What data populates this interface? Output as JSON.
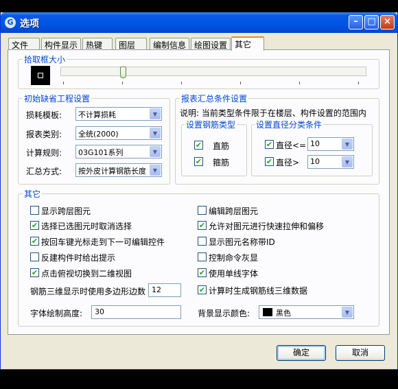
{
  "window": {
    "title": "选项"
  },
  "tabs": [
    "文件",
    "构件显示",
    "热键",
    "图层",
    "编制信息",
    "绘图设置",
    "其它"
  ],
  "pick_box": {
    "title": "拾取框大小"
  },
  "defaults_group": {
    "title": "初始缺省工程设置",
    "rows": [
      {
        "label": "损耗模板:",
        "value": "不计算损耗"
      },
      {
        "label": "报表类别:",
        "value": "全统(2000)"
      },
      {
        "label": "计算规则:",
        "value": "03G101系列"
      },
      {
        "label": "汇总方式:",
        "value": "按外皮计算钢筋长度"
      }
    ]
  },
  "report_group": {
    "title": "报表汇总条件设置",
    "note": "说明: 当前类型条件限于在楼层、构件设置的范围内",
    "rebar_type": {
      "title": "设置钢筋类型",
      "items": [
        "直筋",
        "箍筋"
      ]
    },
    "diameter": {
      "title": "设置直径分类条件",
      "rows": [
        {
          "label": "直径<=",
          "value": "10"
        },
        {
          "label": "直径>",
          "value": "10"
        }
      ]
    }
  },
  "other_group": {
    "title": "其它",
    "left_checks": [
      {
        "label": "显示跨层图元",
        "checked": false
      },
      {
        "label": "选择已选图元时取消选择",
        "checked": true
      },
      {
        "label": "按回车键光标走到下一可编辑控件",
        "checked": true
      },
      {
        "label": "反建构件时给出提示",
        "checked": false
      },
      {
        "label": "点击俯视切换到二维视图",
        "checked": true
      }
    ],
    "right_checks": [
      {
        "label": "编辑跨层图元",
        "checked": false
      },
      {
        "label": "允许对图元进行快速拉伸和偏移",
        "checked": true
      },
      {
        "label": "显示图元名称带ID",
        "checked": false
      },
      {
        "label": "控制命令灰显",
        "checked": false
      },
      {
        "label": "使用单线字体",
        "checked": true
      },
      {
        "label": "计算时生成钢筋线三维数据",
        "checked": true
      }
    ],
    "polygon_label": "钢筋三维显示时使用多边形边数",
    "polygon_value": "12",
    "font_height_label": "字体绘制高度:",
    "font_height_value": "30",
    "bg_color_label": "背景显示颜色:",
    "bg_color_value": "黑色"
  },
  "buttons": {
    "ok": "确定",
    "cancel": "取消"
  },
  "colors": {
    "titlebar": "#0054e3",
    "legend": "#0046d5",
    "check": "#21a121"
  }
}
